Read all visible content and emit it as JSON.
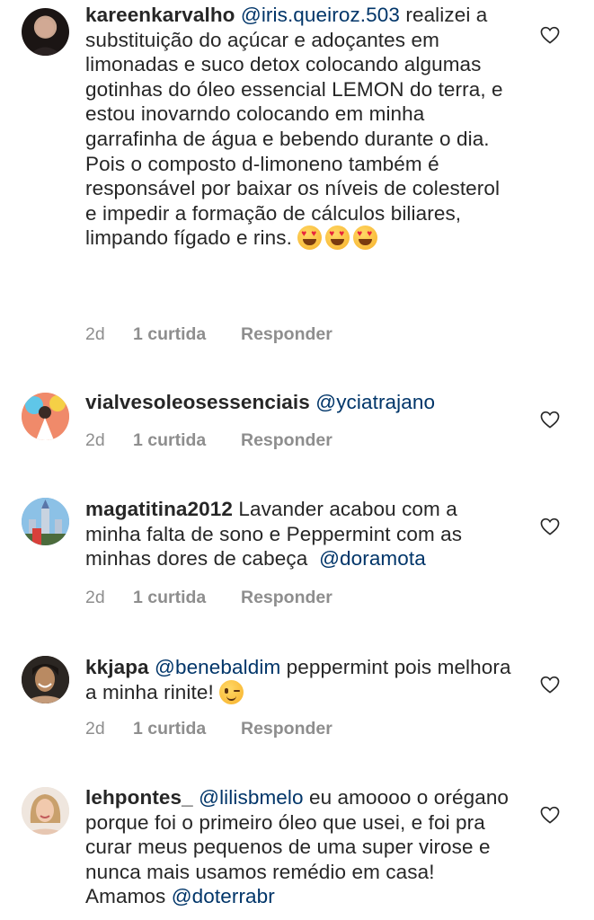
{
  "comments": [
    {
      "username": "kareenkarvalho",
      "mention": "@iris.queiroz.503",
      "text": "realizei a substituição do açúcar e adoçantes em limonadas e suco detox colocando algumas gotinhas do óleo essencial LEMON do terra, e estou inovarndo colocando em minha garrafinha de água e bebendo durante o dia. Pois o composto d-limoneno também é responsável por baixar os níveis de colesterol e impedir a formação de cálculos biliares, limpando fígado e rins.",
      "time": "2d",
      "likes": "1 curtida",
      "reply": "Responder"
    },
    {
      "username": "vialvesoleosessenciais",
      "mention": "@yciatrajano",
      "time": "2d",
      "likes": "1 curtida",
      "reply": "Responder"
    },
    {
      "username": "magatitina2012",
      "text": "Lavander acabou com a minha falta de sono e Peppermint com as minhas dores de cabeça",
      "mention": "@doramota",
      "time": "2d",
      "likes": "1 curtida",
      "reply": "Responder"
    },
    {
      "username": "kkjapa",
      "mention": "@benebaldim",
      "text": "peppermint pois melhora a minha rinite!",
      "time": "2d",
      "likes": "1 curtida",
      "reply": "Responder"
    },
    {
      "username": "lehpontes_",
      "mention": "@lilisbmelo",
      "text": "eu amoooo o orégano porque foi o primeiro óleo que usei, e foi pra curar meus pequenos de uma super virose e nunca mais usamos remédio em casa! Amamos",
      "mention2": "@doterrabr"
    }
  ],
  "icons": {
    "like": "heart-outline-icon"
  },
  "colors": {
    "mention": "#003569",
    "meta": "#8e8e8e",
    "text": "#262626"
  }
}
